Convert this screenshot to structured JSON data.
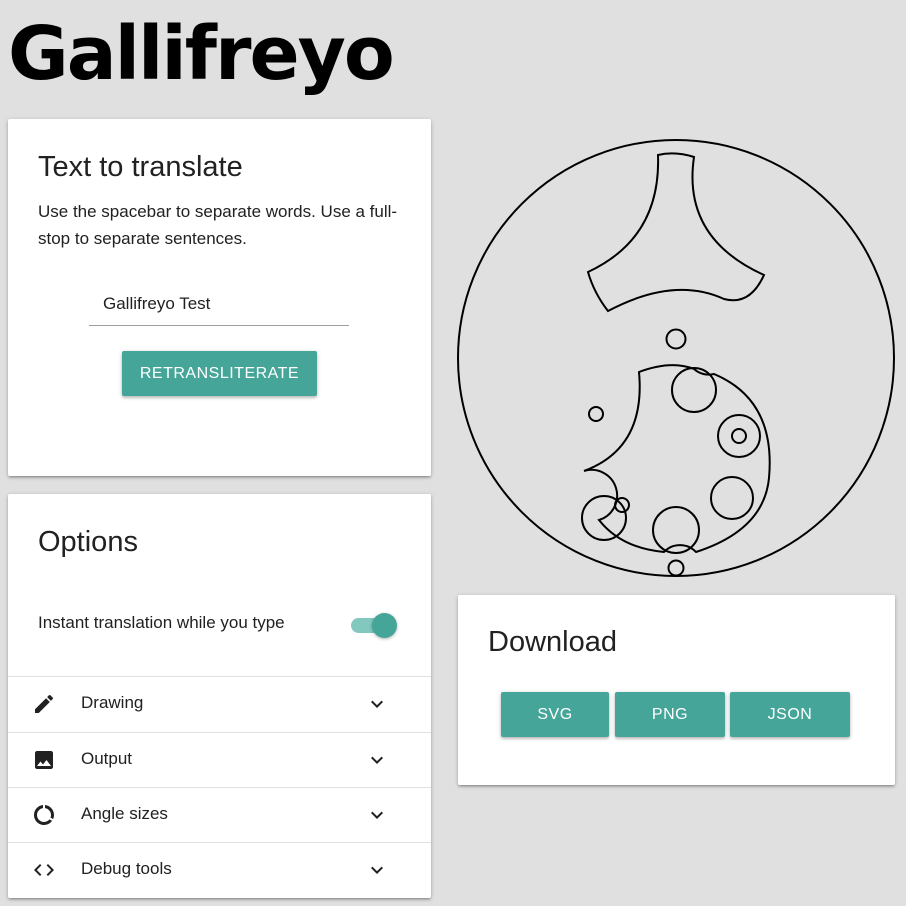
{
  "app": {
    "title": "Gallifreyo"
  },
  "translate": {
    "title": "Text to translate",
    "instructions": "Use the spacebar to separate words. Use a full-stop to separate sentences.",
    "input_value": "Gallifreyo Test",
    "button_label": "RETRANSLITERATE"
  },
  "options": {
    "title": "Options",
    "instant_label": "Instant translation while you type",
    "instant_enabled": true,
    "sections": [
      {
        "label": "Drawing",
        "icon": "pencil-icon"
      },
      {
        "label": "Output",
        "icon": "image-icon"
      },
      {
        "label": "Angle sizes",
        "icon": "donut-icon"
      },
      {
        "label": "Debug tools",
        "icon": "code-icon"
      }
    ]
  },
  "download": {
    "title": "Download",
    "buttons": [
      "SVG",
      "PNG",
      "JSON"
    ]
  },
  "colors": {
    "accent": "#45a598",
    "accent_light": "#83c8be",
    "background": "#e0e0e0"
  }
}
